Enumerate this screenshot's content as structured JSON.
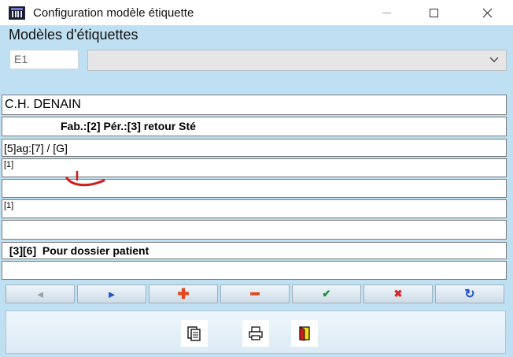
{
  "window": {
    "title": "Configuration modèle étiquette",
    "minimize_glyph": "—",
    "maximize_glyph": "☐",
    "close_glyph": "✕"
  },
  "header": {
    "section_title": "Modèles d'étiquettes",
    "code_value": "E1",
    "model_select_value": "",
    "chevron_glyph": "﹀"
  },
  "label_rows": [
    "C.H. DENAIN",
    "Fab.:[2] Pér.:[3] retour Sté",
    "[5]ag:[7] / [G]",
    "[1]",
    "",
    "[1]",
    "",
    " [3][6]  Pour dossier patient",
    ""
  ],
  "nav_buttons": {
    "first": "◄",
    "next": "►",
    "add": "✚",
    "delete": "━",
    "validate": "✔",
    "cancel": "✖",
    "refresh": "↻"
  },
  "icons": {
    "copy": "copy-icon",
    "print": "print-icon",
    "exit": "exit-icon"
  },
  "colors": {
    "client_background": "#bfe0f2",
    "annotation_red": "#d11a1a",
    "accent_blue": "#1a52c9"
  }
}
